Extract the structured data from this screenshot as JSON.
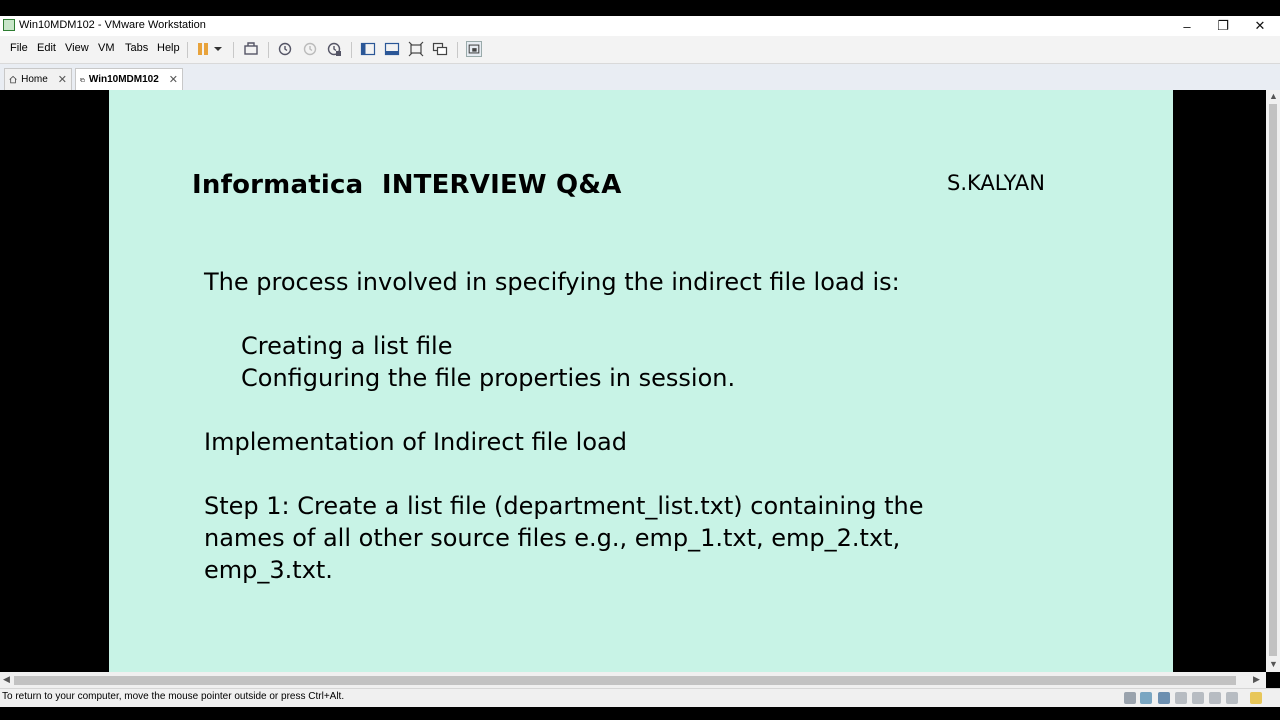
{
  "window": {
    "title": "Win10MDM102 - VMware Workstation",
    "controls": {
      "minimize": "–",
      "restore": "❐",
      "close": "✕"
    }
  },
  "menu": [
    "File",
    "Edit",
    "View",
    "VM",
    "Tabs",
    "Help"
  ],
  "tabs": [
    {
      "label": "Home",
      "close": "✕"
    },
    {
      "label": "Win10MDM102",
      "close": "✕"
    }
  ],
  "slide": {
    "title": "Informatica  INTERVIEW Q&A",
    "author": "S.KALYAN",
    "lines": [
      "The process involved in specifying the indirect file load is:",
      "Creating a list file",
      "Configuring the file properties in session.",
      "Implementation of Indirect file load",
      "Step 1: Create a list file (department_list.txt) containing the",
      "names of all other source files e.g., emp_1.txt, emp_2.txt,",
      "emp_3.txt."
    ]
  },
  "scroll": {
    "up": "▲",
    "down": "▼",
    "left": "◀",
    "right": "▶"
  },
  "status": {
    "message": "To return to your computer, move the mouse pointer outside or press Ctrl+Alt."
  },
  "colors": {
    "slide_background": "#c8f3e6",
    "vm_background": "#000000",
    "pause_accent": "#e8a33c"
  }
}
